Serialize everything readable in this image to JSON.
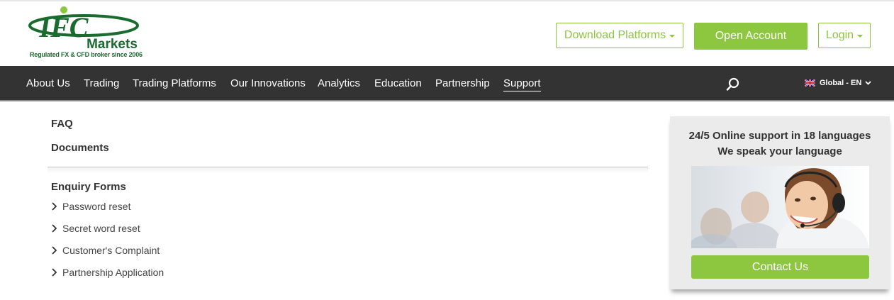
{
  "brand": {
    "logo_main": "IFC",
    "logo_sub": "Markets",
    "tagline": "Regulated FX & CFD broker since 2006",
    "colors": {
      "green_dark": "#1a6b2e",
      "green_accent": "#8dc63f",
      "nav_bg": "#333333"
    }
  },
  "header": {
    "download_label": "Download Platforms",
    "open_account_label": "Open Account",
    "login_label": "Login"
  },
  "nav": {
    "items": [
      {
        "label": "About Us"
      },
      {
        "label": "Trading"
      },
      {
        "label": "Trading Platforms"
      },
      {
        "label": "Our Innovations"
      },
      {
        "label": "Analytics"
      },
      {
        "label": "Education"
      },
      {
        "label": "Partnership"
      },
      {
        "label": "Support"
      }
    ],
    "active": "Support",
    "search_icon": "search-icon",
    "language_label": "Global - EN",
    "language_flag": "uk-flag-icon"
  },
  "main": {
    "faq_label": "FAQ",
    "documents_label": "Documents",
    "enquiry_title": "Enquiry Forms",
    "enquiry_items": [
      {
        "label": "Password reset"
      },
      {
        "label": "Secret word reset"
      },
      {
        "label": "Customer's Complaint"
      },
      {
        "label": "Partnership Application"
      }
    ]
  },
  "support_panel": {
    "title_line1": "24/5 Online support in 18 languages",
    "title_line2": "We speak your language",
    "contact_label": "Contact Us"
  }
}
